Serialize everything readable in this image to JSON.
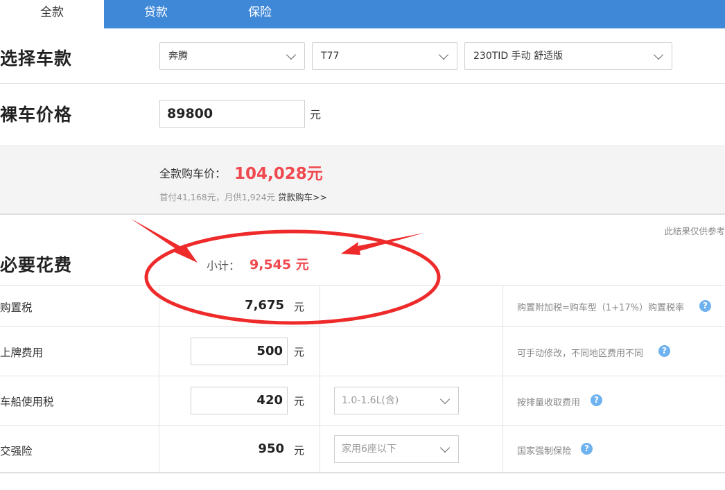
{
  "tabs": [
    {
      "label": "全款",
      "active": true
    },
    {
      "label": "贷款",
      "active": false
    },
    {
      "label": "保险",
      "active": false
    }
  ],
  "select_car": {
    "title": "选择车款",
    "brand": "奔腾",
    "series": "T77",
    "model": "230TID 手动 舒适版"
  },
  "bare_price": {
    "title": "裸车价格",
    "value": "89800",
    "unit": "元"
  },
  "summary": {
    "total_label": "全款购车价：",
    "total_value": "104,028元",
    "sub_text": "首付41,168元，月供1,924元",
    "loan_link": "贷款购车>>"
  },
  "required": {
    "disclaimer": "此结果仅供参考",
    "title": "必要花费",
    "subtotal_label": "小计：",
    "subtotal_value": "9,545 元",
    "rows": [
      {
        "label": "购置税",
        "amount": "7,675",
        "unit": "元",
        "option": "",
        "note": "购置附加税=购车型（1+17%）购置税率"
      },
      {
        "label": "上牌费用",
        "amount": "500",
        "unit": "元",
        "option": "",
        "note": "可手动修改，不同地区费用不同"
      },
      {
        "label": "车船使用税",
        "amount": "420",
        "unit": "元",
        "option": "1.0-1.6L(含)",
        "note": "按排量收取费用"
      },
      {
        "label": "交强险",
        "amount": "950",
        "unit": "元",
        "option": "家用6座以下",
        "note": "国家强制保险"
      }
    ]
  },
  "colors": {
    "tab_bar": "#3f88d8",
    "price_red": "#f0484f",
    "annotation_red": "#ee2a2a",
    "help_icon": "#6eb2ef"
  },
  "icons": {
    "dropdown": "chevron-down-icon",
    "help": "question-circle-icon"
  }
}
